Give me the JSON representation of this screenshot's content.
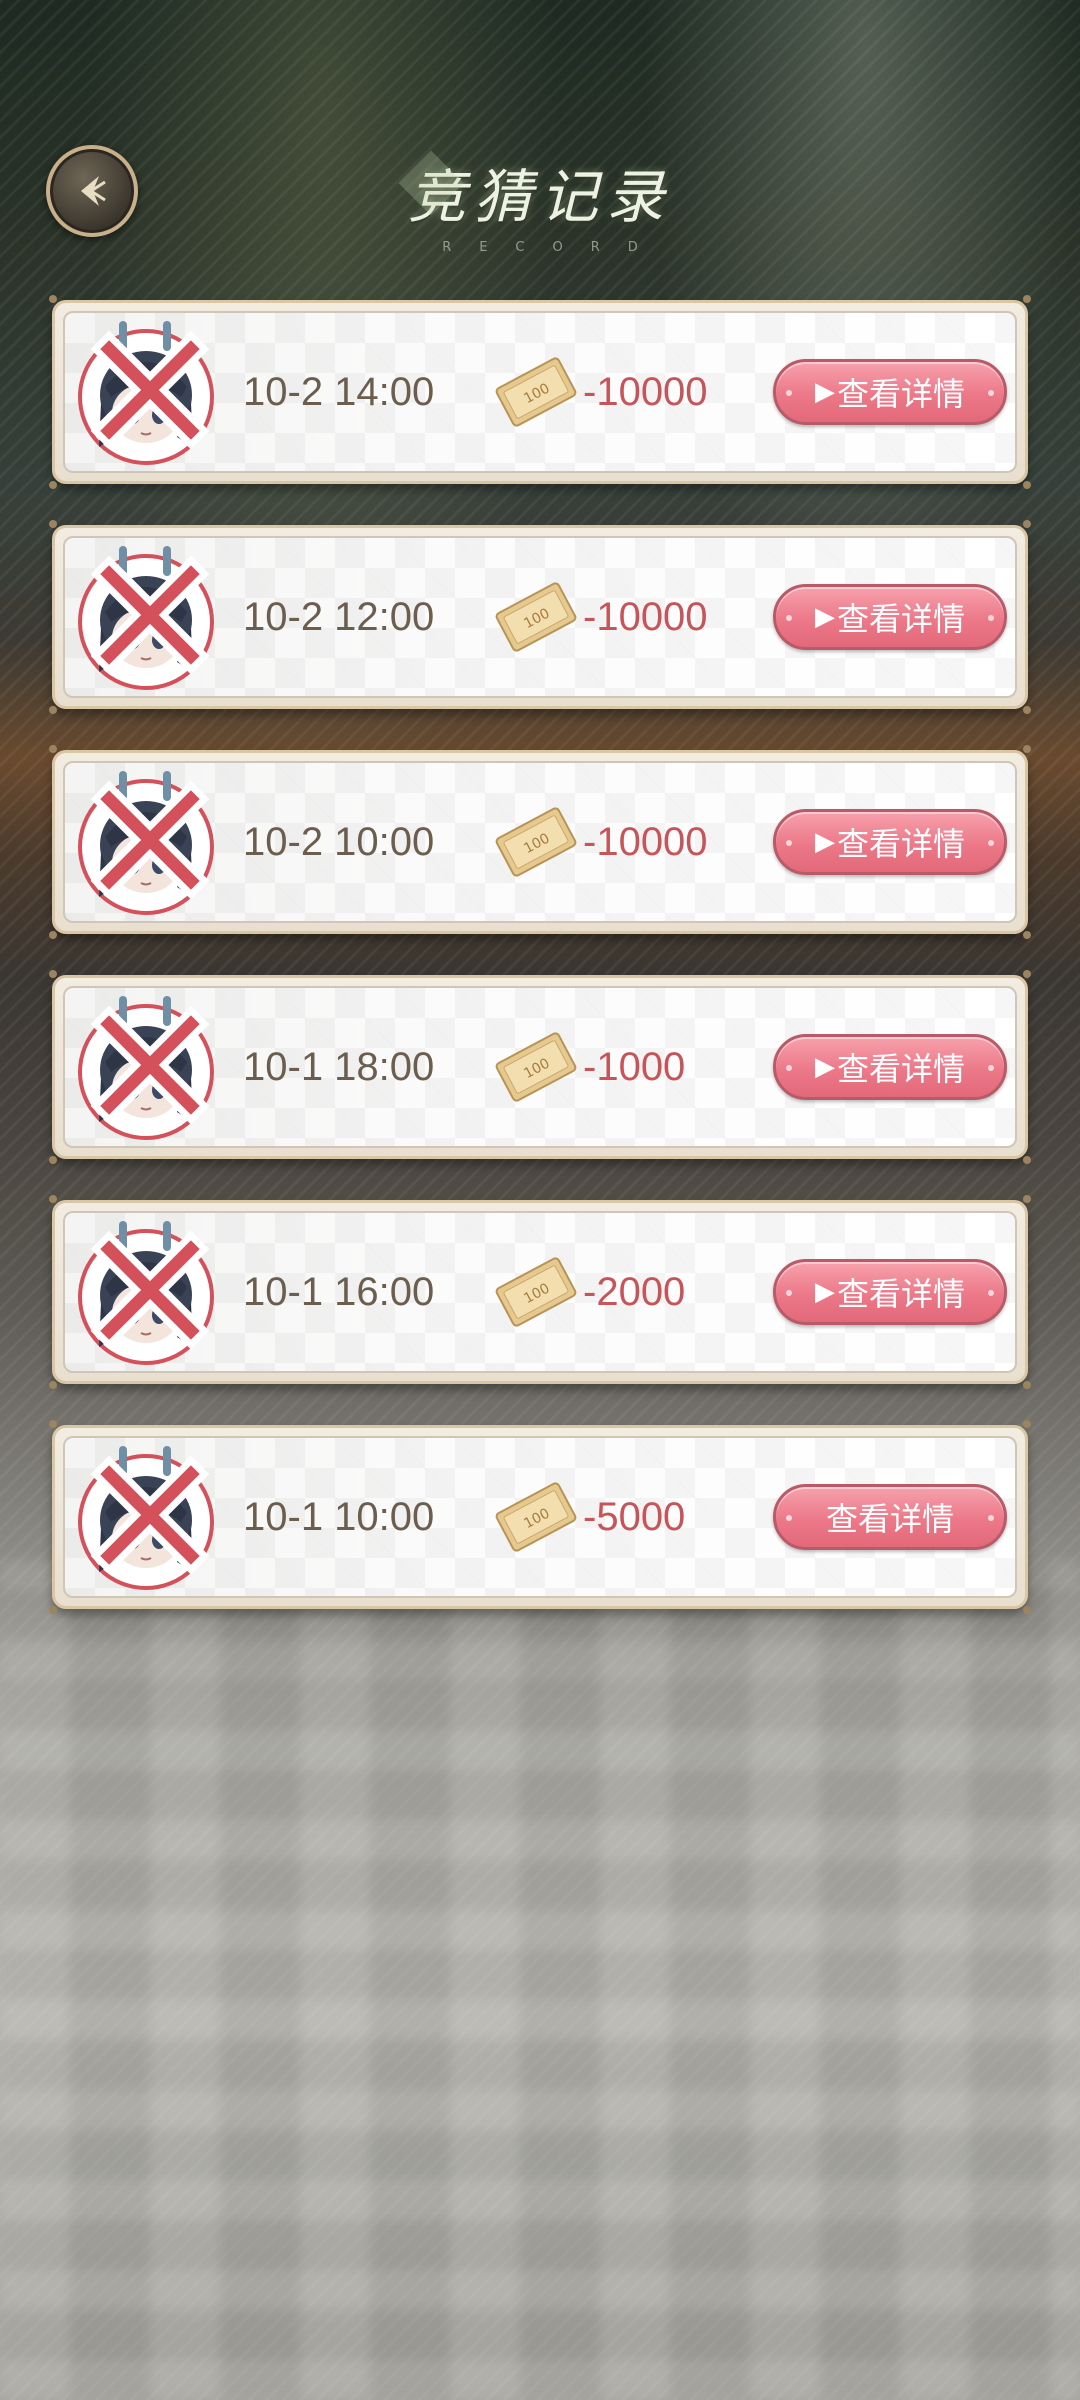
{
  "header": {
    "title": "竞猜记录",
    "subtitle": "RECORD",
    "back_icon": "back-arrow-icon"
  },
  "records": [
    {
      "time": "10-2 14:00",
      "amount": "-10000",
      "button_label": "查看详情",
      "show_play": true,
      "result": "lose"
    },
    {
      "time": "10-2 12:00",
      "amount": "-10000",
      "button_label": "查看详情",
      "show_play": true,
      "result": "lose"
    },
    {
      "time": "10-2 10:00",
      "amount": "-10000",
      "button_label": "查看详情",
      "show_play": true,
      "result": "lose"
    },
    {
      "time": "10-1 18:00",
      "amount": "-1000",
      "button_label": "查看详情",
      "show_play": true,
      "result": "lose"
    },
    {
      "time": "10-1 16:00",
      "amount": "-2000",
      "button_label": "查看详情",
      "show_play": true,
      "result": "lose"
    },
    {
      "time": "10-1 10:00",
      "amount": "-5000",
      "button_label": "查看详情",
      "show_play": false,
      "result": "lose"
    }
  ],
  "ticket_value": "100",
  "play_symbol": "▶",
  "colors": {
    "amount": "#c6555a",
    "button": "#ec7888",
    "time": "#6b5e4e",
    "lose_mark": "#d4505a"
  }
}
